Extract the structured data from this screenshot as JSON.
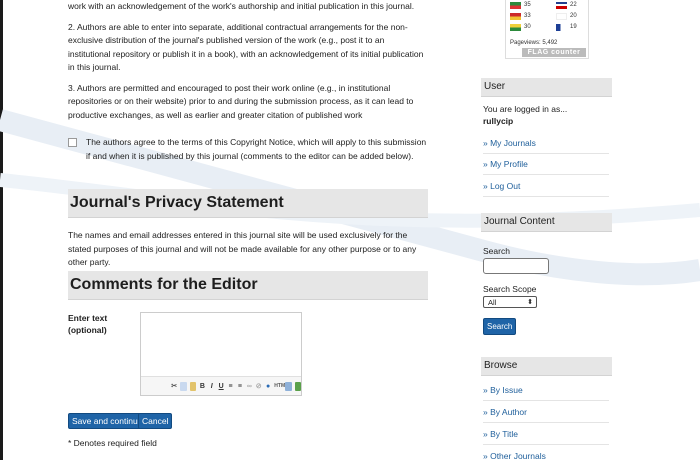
{
  "terms": {
    "para1": "work with an acknowledgement of the work's authorship and initial publication in this journal.",
    "para2": "2. Authors are able to enter into separate, additional contractual arrangements for the non-exclusive distribution of the journal's published version of the work (e.g., post it to an institutional repository or publish it in a book), with an acknowledgement of its initial publication in this journal.",
    "para3": "3. Authors are permitted and encouraged to post their work online (e.g., in institutional repositories or on their website) prior to and during the submission process, as it can lead to productive exchanges, as well as earlier and greater citation of published work",
    "consent": "The authors agree to the terms of this Copyright Notice, which will apply to this submission if and when it is published by this journal (comments to the editor can be added below)."
  },
  "privacy": {
    "heading": "Journal's Privacy Statement",
    "text": "The names and email addresses entered in this journal site will be used exclusively for the stated purposes of this journal and will not be made available for any other purpose or to any other party."
  },
  "comments": {
    "heading": "Comments for the Editor",
    "field_label": "Enter text (optional)",
    "editor_value": ""
  },
  "actions": {
    "save_label": "Save and continue",
    "cancel_label": "Cancel",
    "required_note": "* Denotes required field"
  },
  "flag_counter": {
    "rows": [
      {
        "count_left": "35",
        "count_right": "22"
      },
      {
        "count_left": "33",
        "count_right": "20"
      },
      {
        "count_left": "30",
        "count_right": "19"
      }
    ],
    "pageviews": "Pageviews: 5,492",
    "brand": "FLAG counter"
  },
  "sidebar": {
    "user_heading": "User",
    "logged_in_as": "You are logged in as...",
    "username": "rullycip",
    "user_links": [
      "» My Journals",
      "» My Profile",
      "» Log Out"
    ],
    "content_heading": "Journal Content",
    "search_label": "Search",
    "search_value": "",
    "scope_label": "Search Scope",
    "scope_selected": "All",
    "search_button": "Search",
    "browse_heading": "Browse",
    "browse_links": [
      "» By Issue",
      "» By Author",
      "» By Title",
      "» Other Journals"
    ]
  },
  "colors": {
    "link": "#1f5f9b",
    "button": "#1f64a7",
    "heading_bg": "#e6e6e6"
  }
}
